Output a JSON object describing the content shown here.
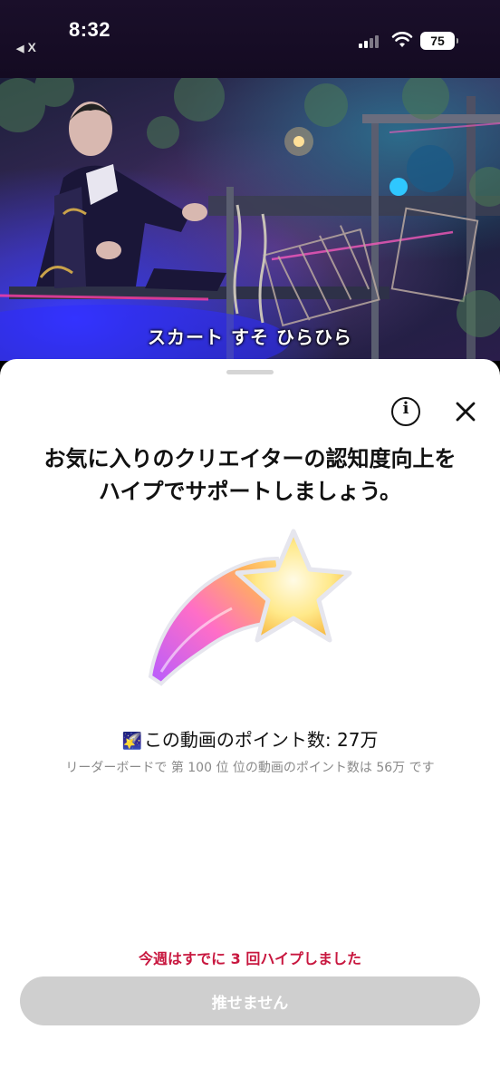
{
  "status_bar": {
    "time": "8:32",
    "back_app_label": "X",
    "battery_level": "75"
  },
  "video": {
    "subtitle": "スカート すそ ひらひら"
  },
  "sheet": {
    "headline_line1": "お気に入りのクリエイターの認知度向上を",
    "headline_line2": "ハイプでサポートしましょう。",
    "points_label": "この動画のポイント数: 27万",
    "leaderboard_text": "リーダーボードで 第 100 位 位の動画のポイント数は 56万 です",
    "weekly_notice": "今週はすでに 3 回ハイプしました",
    "cta_label": "推せません",
    "icons": {
      "info": "info-icon",
      "close": "close-icon",
      "hero": "shooting-star-icon",
      "mini": "mini-shooting-star-icon"
    },
    "colors": {
      "notice": "#c8173f",
      "cta_disabled": "#cfcfcf"
    }
  }
}
